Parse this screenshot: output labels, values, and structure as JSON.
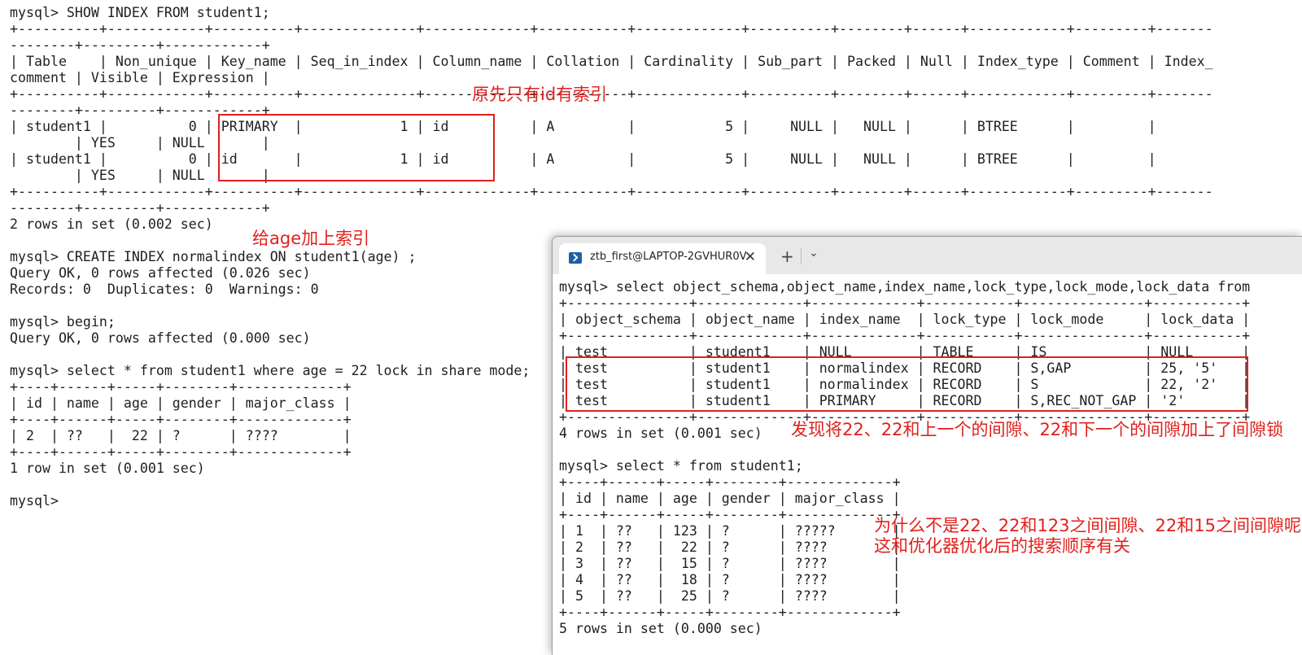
{
  "main_terminal": {
    "lines": [
      "mysql> SHOW INDEX FROM student1;",
      "+----------+------------+----------+--------------+-------------+-----------+-------------+----------+--------+------+------------+---------+-------",
      "--------+---------+------------+",
      "| Table    | Non_unique | Key_name | Seq_in_index | Column_name | Collation | Cardinality | Sub_part | Packed | Null | Index_type | Comment | Index_",
      "comment | Visible | Expression |",
      "+----------+------------+----------+--------------+-------------+-----------+-------------+----------+--------+------+------------+---------+-------",
      "--------+---------+------------+",
      "| student1 |          0 | PRIMARY  |            1 | id          | A         |           5 |     NULL |   NULL |      | BTREE      |         |",
      "        | YES     | NULL       |",
      "| student1 |          0 | id       |            1 | id          | A         |           5 |     NULL |   NULL |      | BTREE      |         |",
      "        | YES     | NULL       |",
      "+----------+------------+----------+--------------+-------------+-----------+-------------+----------+--------+------+------------+---------+-------",
      "--------+---------+------------+",
      "2 rows in set (0.002 sec)",
      "",
      "mysql> CREATE INDEX normalindex ON student1(age) ;",
      "Query OK, 0 rows affected (0.026 sec)",
      "Records: 0  Duplicates: 0  Warnings: 0",
      "",
      "mysql> begin;",
      "Query OK, 0 rows affected (0.000 sec)",
      "",
      "mysql> select * from student1 where age = 22 lock in share mode;",
      "+----+------+-----+--------+-------------+",
      "| id | name | age | gender | major_class |",
      "+----+------+-----+--------+-------------+",
      "| 2  | ??   |  22 | ?      | ????        |",
      "+----+------+-----+--------+-------------+",
      "1 row in set (0.001 sec)",
      "",
      "mysql>"
    ]
  },
  "annotations": {
    "index_note": "原先只有id有索引",
    "age_index_note": "给age加上索引",
    "gap_lock_note": "发现将22、22和上一个的间隙、22和下一个的间隙加上了间隙锁",
    "question_note_line1": "为什么不是22、22和123之间间隙、22和15之间间隙呢",
    "question_note_line2": "这和优化器优化后的搜索顺序有关"
  },
  "second_window": {
    "tab_title": "ztb_first@LAPTOP-2GVHUR0V",
    "tab_close": "✕",
    "new_tab": "+",
    "dropdown": "⌄",
    "lines": [
      "mysql> select object_schema,object_name,index_name,lock_type,lock_mode,lock_data from",
      "+---------------+-------------+-------------+-----------+---------------+-----------+",
      "| object_schema | object_name | index_name  | lock_type | lock_mode     | lock_data |",
      "+---------------+-------------+-------------+-----------+---------------+-----------+",
      "| test          | student1    | NULL        | TABLE     | IS            | NULL      |",
      "| test          | student1    | normalindex | RECORD    | S,GAP         | 25, '5'   |",
      "| test          | student1    | normalindex | RECORD    | S             | 22, '2'   |",
      "| test          | student1    | PRIMARY     | RECORD    | S,REC_NOT_GAP | '2'       |",
      "+---------------+-------------+-------------+-----------+---------------+-----------+",
      "4 rows in set (0.001 sec)",
      "",
      "mysql> select * from student1;",
      "+----+------+-----+--------+-------------+",
      "| id | name | age | gender | major_class |",
      "+----+------+-----+--------+-------------+",
      "| 1  | ??   | 123 | ?      | ?????       |",
      "| 2  | ??   |  22 | ?      | ????        |",
      "| 3  | ??   |  15 | ?      | ????        |",
      "| 4  | ??   |  18 | ?      | ????        |",
      "| 5  | ??   |  25 | ?      | ????        |",
      "+----+------+-----+--------+-------------+",
      "5 rows in set (0.000 sec)"
    ]
  },
  "colors": {
    "annotation": "#e0201c",
    "text": "#1f1f1f",
    "tab_icon": "#1e5fa8"
  }
}
